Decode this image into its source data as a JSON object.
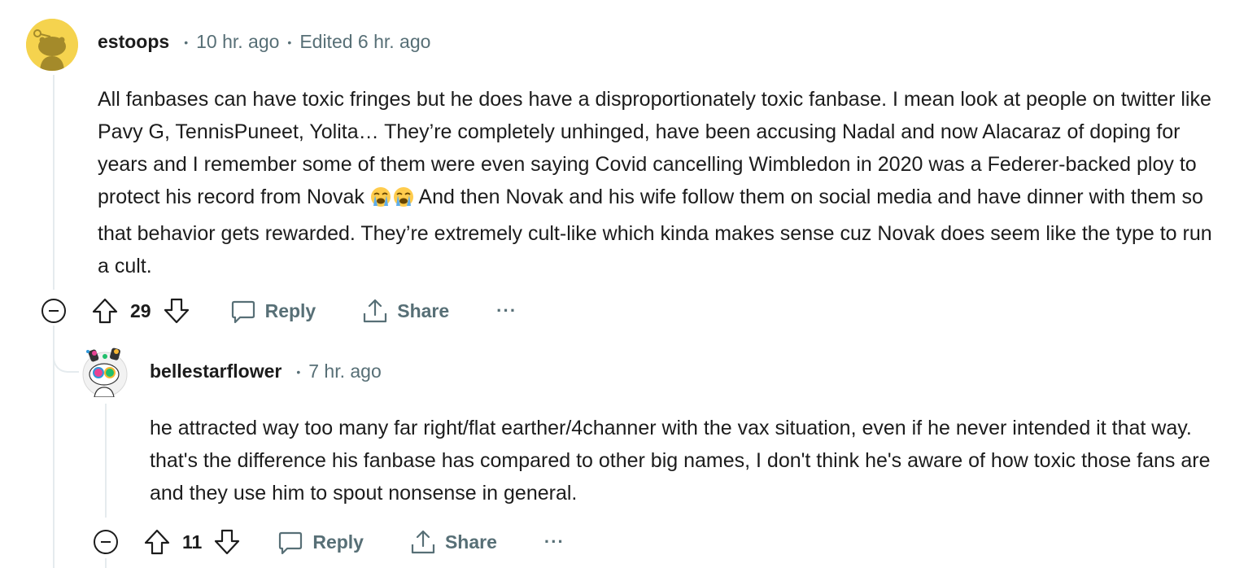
{
  "comments": [
    {
      "username": "estoops",
      "time": "10 hr. ago",
      "edited": "Edited 6 hr. ago",
      "body_parts": [
        "All fanbases can have toxic fringes but he does have a disproportionately toxic fanbase. I mean look at people on twitter like Pavy G, TennisPuneet, Yolita… They’re completely unhinged, have been accusing Nadal and now Alacaraz of doping for years and I remember some of them were even saying Covid cancelling Wimbledon in 2020 was a Federer-backed ploy to protect his record from Novak",
        " And then Novak and his wife follow them on social media and have dinner with them so that behavior gets rewarded. They’re extremely cult-like which kinda makes sense cuz Novak does seem like the type to run a cult."
      ],
      "emoji": "loudly-crying-face x2",
      "votes": "29",
      "reply_label": "Reply",
      "share_label": "Share",
      "more_label": "···"
    },
    {
      "username": "bellestarflower",
      "time": "7 hr. ago",
      "body": "he attracted way too many far right/flat earther/4channer with the vax situation, even if he never intended it that way. that's the difference his fanbase has compared to other big names, I don't think he's aware of how toxic those fans are and they use him to spout nonsense in general.",
      "votes": "11",
      "reply_label": "Reply",
      "share_label": "Share",
      "more_label": "···"
    }
  ],
  "colors": {
    "meta": "#576f76",
    "thread_line": "#e5ebee",
    "avatar1_bg": "#f5d34e"
  }
}
